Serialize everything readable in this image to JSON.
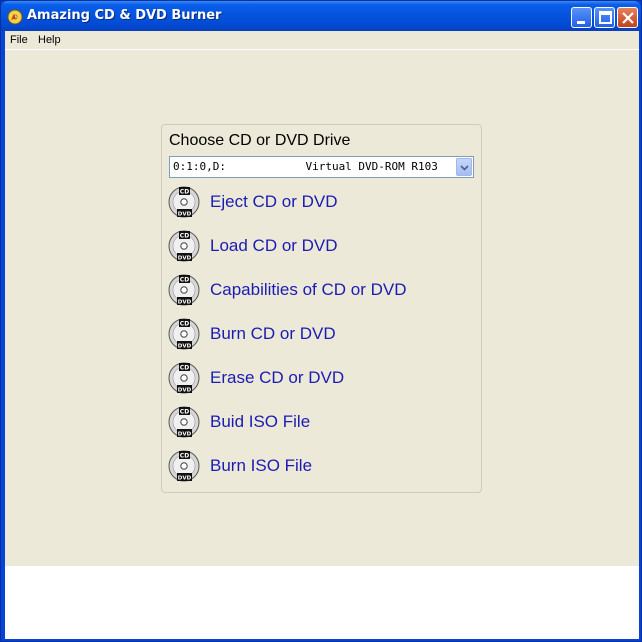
{
  "window": {
    "title": "Amazing CD & DVD Burner"
  },
  "menu": {
    "file": "File",
    "help": "Help"
  },
  "panel": {
    "title": "Choose CD or DVD Drive",
    "drive_selected": "0:1:0,D:            Virtual DVD-ROM R103",
    "actions": [
      {
        "label": "Eject CD or DVD",
        "icon": "cd-dvd-disc-icon"
      },
      {
        "label": "Load CD or DVD",
        "icon": "cd-dvd-disc-icon"
      },
      {
        "label": "Capabilities of CD or DVD",
        "icon": "cd-dvd-disc-icon"
      },
      {
        "label": "Burn CD or DVD",
        "icon": "cd-dvd-disc-icon"
      },
      {
        "label": "Erase CD or DVD",
        "icon": "cd-dvd-disc-icon"
      },
      {
        "label": "Buid ISO File",
        "icon": "cd-dvd-disc-icon"
      },
      {
        "label": "Burn ISO File",
        "icon": "cd-dvd-disc-icon"
      }
    ],
    "icon_badge_top": "CD",
    "icon_badge_bottom": "DVD"
  },
  "colors": {
    "titlebar": "#0554e0",
    "client_bg": "#ece9d8",
    "link_text": "#1b1bb5"
  }
}
